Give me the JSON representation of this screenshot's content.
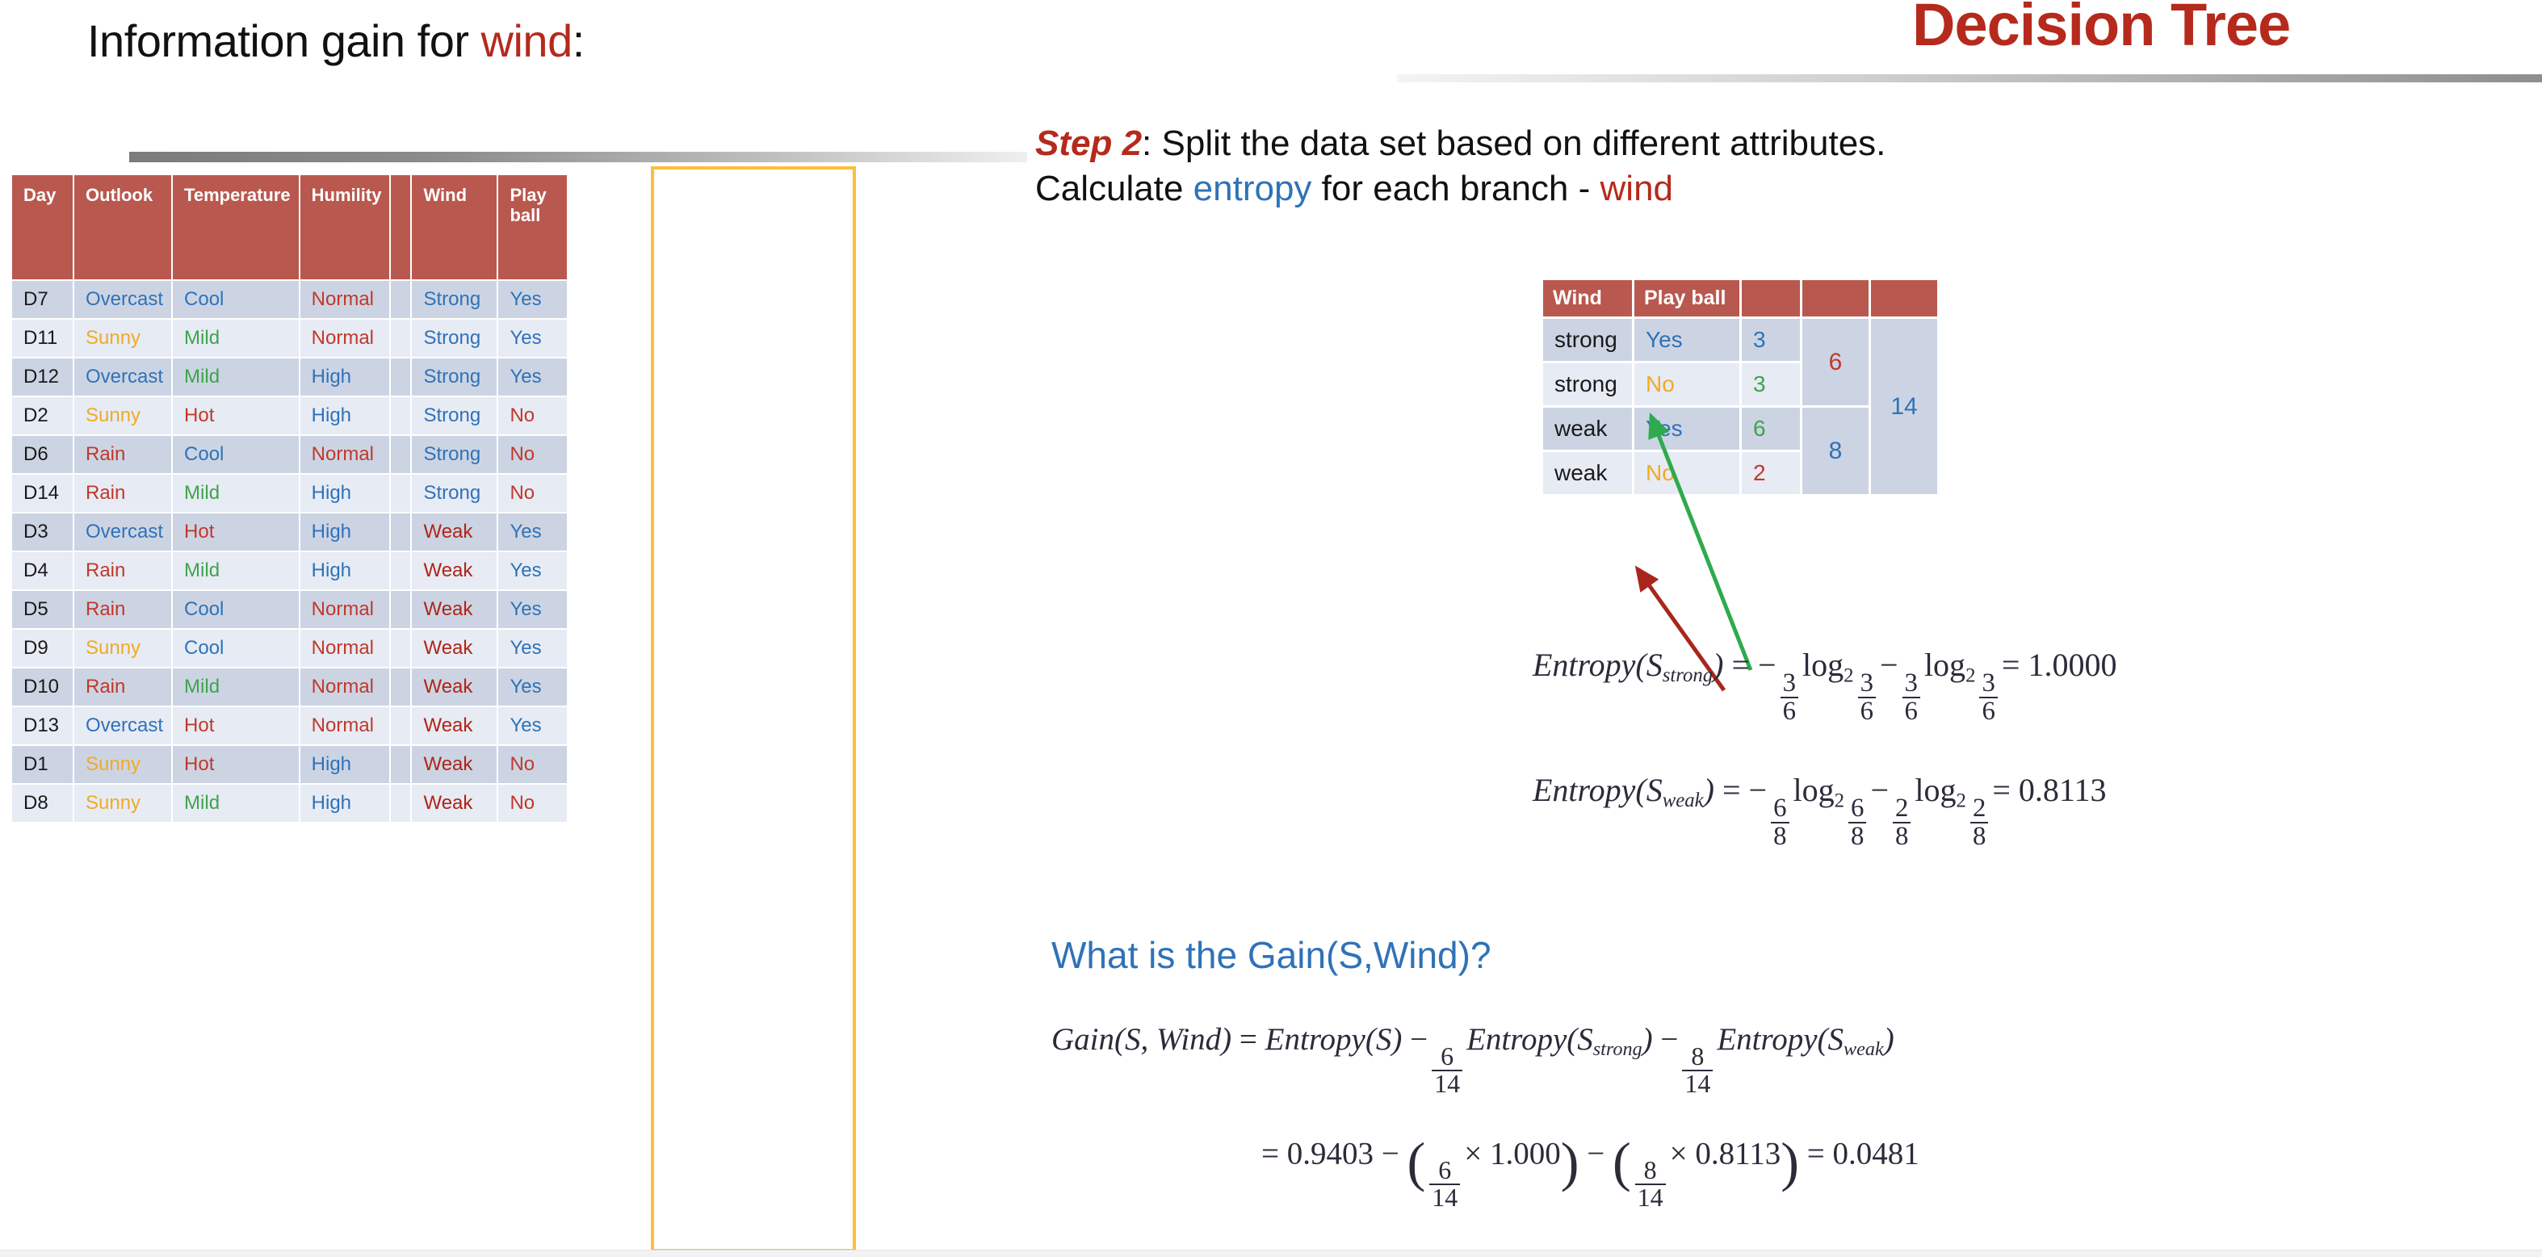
{
  "slide": {
    "left_title_prefix": "Information gain for ",
    "left_title_accent": "wind",
    "left_title_suffix": ":",
    "deck_title": "Decision Tree"
  },
  "step": {
    "label": "Step 2",
    "line1_rest": ": Split the data set based on different attributes.",
    "line2_a": "Calculate ",
    "line2_entropy": "entropy",
    "line2_b": " for each branch - ",
    "line2_wind": "wind"
  },
  "weather_table": {
    "headers": [
      "Day",
      "Outlook",
      "Temperature",
      "Humility",
      "",
      "Wind",
      "Play ball"
    ],
    "rows": [
      {
        "day": "D7",
        "outlook": "Overcast",
        "outlook_c": "c-blue",
        "temp": "Cool",
        "temp_c": "c-blue",
        "hum": "Normal",
        "hum_c": "c-red",
        "wind": "Strong",
        "wind_c": "c-blue",
        "play": "Yes",
        "play_c": "c-blue"
      },
      {
        "day": "D11",
        "outlook": "Sunny",
        "outlook_c": "c-orange",
        "temp": "Mild",
        "temp_c": "c-green",
        "hum": "Normal",
        "hum_c": "c-red",
        "wind": "Strong",
        "wind_c": "c-blue",
        "play": "Yes",
        "play_c": "c-blue"
      },
      {
        "day": "D12",
        "outlook": "Overcast",
        "outlook_c": "c-blue",
        "temp": "Mild",
        "temp_c": "c-green",
        "hum": "High",
        "hum_c": "c-blue",
        "wind": "Strong",
        "wind_c": "c-blue",
        "play": "Yes",
        "play_c": "c-blue"
      },
      {
        "day": "D2",
        "outlook": "Sunny",
        "outlook_c": "c-orange",
        "temp": "Hot",
        "temp_c": "c-red",
        "hum": "High",
        "hum_c": "c-blue",
        "wind": "Strong",
        "wind_c": "c-blue",
        "play": "No",
        "play_c": "c-red"
      },
      {
        "day": "D6",
        "outlook": "Rain",
        "outlook_c": "c-red",
        "temp": "Cool",
        "temp_c": "c-blue",
        "hum": "Normal",
        "hum_c": "c-red",
        "wind": "Strong",
        "wind_c": "c-blue",
        "play": "No",
        "play_c": "c-red"
      },
      {
        "day": "D14",
        "outlook": "Rain",
        "outlook_c": "c-red",
        "temp": "Mild",
        "temp_c": "c-green",
        "hum": "High",
        "hum_c": "c-blue",
        "wind": "Strong",
        "wind_c": "c-blue",
        "play": "No",
        "play_c": "c-red"
      },
      {
        "day": "D3",
        "outlook": "Overcast",
        "outlook_c": "c-blue",
        "temp": "Hot",
        "temp_c": "c-red",
        "hum": "High",
        "hum_c": "c-blue",
        "wind": "Weak",
        "wind_c": "c-dkred",
        "play": "Yes",
        "play_c": "c-blue"
      },
      {
        "day": "D4",
        "outlook": "Rain",
        "outlook_c": "c-red",
        "temp": "Mild",
        "temp_c": "c-green",
        "hum": "High",
        "hum_c": "c-blue",
        "wind": "Weak",
        "wind_c": "c-dkred",
        "play": "Yes",
        "play_c": "c-blue"
      },
      {
        "day": "D5",
        "outlook": "Rain",
        "outlook_c": "c-red",
        "temp": "Cool",
        "temp_c": "c-blue",
        "hum": "Normal",
        "hum_c": "c-red",
        "wind": "Weak",
        "wind_c": "c-dkred",
        "play": "Yes",
        "play_c": "c-blue"
      },
      {
        "day": "D9",
        "outlook": "Sunny",
        "outlook_c": "c-orange",
        "temp": "Cool",
        "temp_c": "c-blue",
        "hum": "Normal",
        "hum_c": "c-red",
        "wind": "Weak",
        "wind_c": "c-dkred",
        "play": "Yes",
        "play_c": "c-blue"
      },
      {
        "day": "D10",
        "outlook": "Rain",
        "outlook_c": "c-red",
        "temp": "Mild",
        "temp_c": "c-green",
        "hum": "Normal",
        "hum_c": "c-red",
        "wind": "Weak",
        "wind_c": "c-dkred",
        "play": "Yes",
        "play_c": "c-blue"
      },
      {
        "day": "D13",
        "outlook": "Overcast",
        "outlook_c": "c-blue",
        "temp": "Hot",
        "temp_c": "c-red",
        "hum": "Normal",
        "hum_c": "c-red",
        "wind": "Weak",
        "wind_c": "c-dkred",
        "play": "Yes",
        "play_c": "c-blue"
      },
      {
        "day": "D1",
        "outlook": "Sunny",
        "outlook_c": "c-orange",
        "temp": "Hot",
        "temp_c": "c-red",
        "hum": "High",
        "hum_c": "c-blue",
        "wind": "Weak",
        "wind_c": "c-dkred",
        "play": "No",
        "play_c": "c-red"
      },
      {
        "day": "D8",
        "outlook": "Sunny",
        "outlook_c": "c-orange",
        "temp": "Mild",
        "temp_c": "c-green",
        "hum": "High",
        "hum_c": "c-blue",
        "wind": "Weak",
        "wind_c": "c-dkred",
        "play": "No",
        "play_c": "c-red"
      }
    ]
  },
  "summary_table": {
    "headers": [
      "Wind",
      "Play ball",
      "",
      "",
      ""
    ],
    "rows": [
      {
        "wind": "strong",
        "play": "Yes",
        "play_c": "c-blue",
        "count": "3",
        "count_c": "c-blue"
      },
      {
        "wind": "strong",
        "play": "No",
        "play_c": "c-orange",
        "count": "3",
        "count_c": "c-green"
      },
      {
        "wind": "weak",
        "play": "Yes",
        "play_c": "c-blue",
        "count": "6",
        "count_c": "c-green"
      },
      {
        "wind": "weak",
        "play": "No",
        "play_c": "c-orange",
        "count": "2",
        "count_c": "c-red"
      }
    ],
    "subtotal_strong": "6",
    "subtotal_weak": "8",
    "total": "14"
  },
  "equations": {
    "entropy_strong_label": "Entropy(S",
    "entropy_strong_sub": "strong",
    "entropy_strong_result": "1.0000",
    "entropy_strong_num": "3",
    "entropy_strong_den": "6",
    "entropy_weak_sub": "weak",
    "entropy_weak_result": "0.8113",
    "entropy_weak_num1": "6",
    "entropy_weak_num2": "2",
    "entropy_weak_den": "8",
    "gain_question": "What is the Gain(S,Wind)?",
    "gain_label": "Gain(S, Wind)",
    "gain_entropy_s": "Entropy(S)",
    "gain_w_strong_num": "6",
    "gain_w_strong_den": "14",
    "gain_w_weak_num": "8",
    "gain_w_weak_den": "14",
    "final_entropy_s": "0.9403",
    "final_strong_entropy": "1.000",
    "final_weak_entropy": "0.8113",
    "final_result": "0.0481"
  },
  "colors": {
    "brand_red": "#b52a1c",
    "table_header": "#b9584f",
    "row_dark": "#ccd4e3",
    "row_light": "#e7ebf4",
    "highlight_yellow": "#fbbf3b",
    "link_blue": "#2f72b8",
    "arrow_green": "#2faa4e",
    "arrow_red": "#a8261c"
  }
}
